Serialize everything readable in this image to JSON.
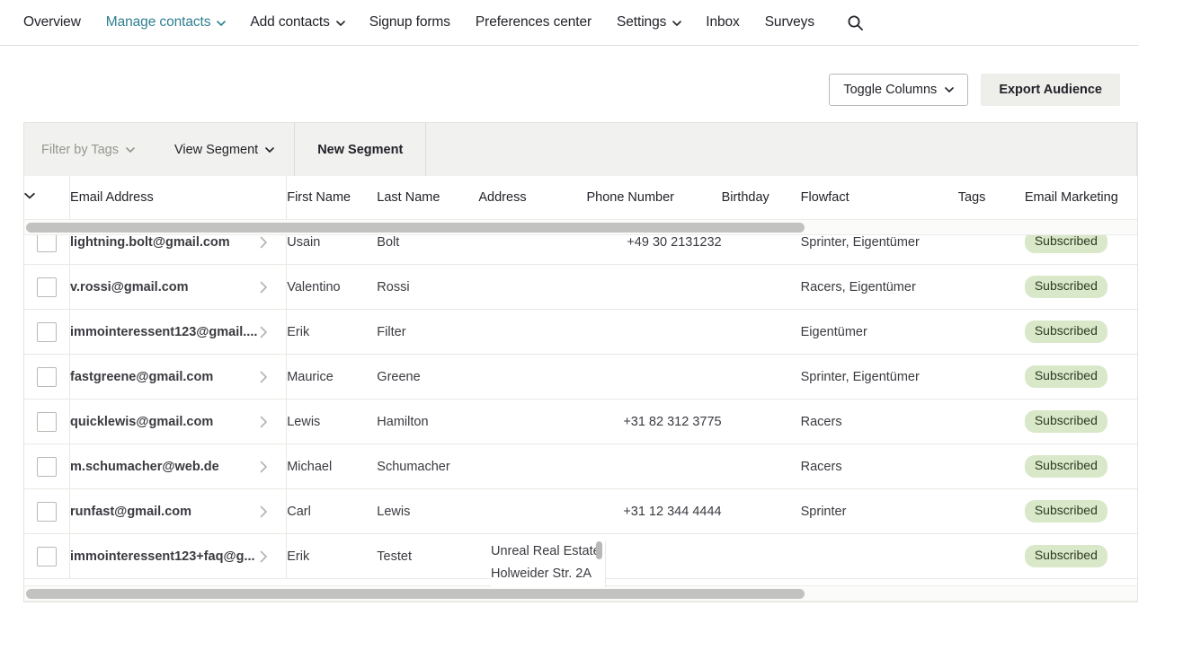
{
  "nav": {
    "items": [
      {
        "label": "Overview",
        "has_caret": false,
        "active": false
      },
      {
        "label": "Manage contacts",
        "has_caret": true,
        "active": true
      },
      {
        "label": "Add contacts",
        "has_caret": true,
        "active": false
      },
      {
        "label": "Signup forms",
        "has_caret": false,
        "active": false
      },
      {
        "label": "Preferences center",
        "has_caret": false,
        "active": false
      },
      {
        "label": "Settings",
        "has_caret": true,
        "active": false
      },
      {
        "label": "Inbox",
        "has_caret": false,
        "active": false
      },
      {
        "label": "Surveys",
        "has_caret": false,
        "active": false
      }
    ],
    "search_icon": "search-icon"
  },
  "actions": {
    "toggle_columns": "Toggle Columns",
    "export_audience": "Export Audience"
  },
  "filterbar": {
    "filter_by_tags": "Filter by Tags",
    "view_segment": "View Segment",
    "new_segment": "New Segment"
  },
  "table": {
    "headers": {
      "select_all": "",
      "email": "Email Address",
      "first_name": "First Name",
      "last_name": "Last Name",
      "address": "Address",
      "phone": "Phone Number",
      "birthday": "Birthday",
      "flowfact": "Flowfact",
      "tags": "Tags",
      "email_marketing": "Email Marketing"
    },
    "rows": [
      {
        "email": "lightning.bolt@gmail.com",
        "first_name": "Usain",
        "last_name": "Bolt",
        "address": "",
        "phone": "+49 30 2131232",
        "birthday": "",
        "flowfact": "Sprinter, Eigentümer",
        "tags": "",
        "email_marketing": "Subscribed"
      },
      {
        "email": "v.rossi@gmail.com",
        "first_name": "Valentino",
        "last_name": "Rossi",
        "address": "",
        "phone": "",
        "birthday": "",
        "flowfact": "Racers, Eigentümer",
        "tags": "",
        "email_marketing": "Subscribed"
      },
      {
        "email": "immointeressent123@gmail....",
        "first_name": "Erik",
        "last_name": "Filter",
        "address": "",
        "phone": "",
        "birthday": "",
        "flowfact": "Eigentümer",
        "tags": "",
        "email_marketing": "Subscribed"
      },
      {
        "email": "fastgreene@gmail.com",
        "first_name": "Maurice",
        "last_name": "Greene",
        "address": "",
        "phone": "",
        "birthday": "",
        "flowfact": "Sprinter, Eigentümer",
        "tags": "",
        "email_marketing": "Subscribed"
      },
      {
        "email": "quicklewis@gmail.com",
        "first_name": "Lewis",
        "last_name": "Hamilton",
        "address": "",
        "phone": "+31 82 312 3775",
        "birthday": "",
        "flowfact": "Racers",
        "tags": "",
        "email_marketing": "Subscribed"
      },
      {
        "email": "m.schumacher@web.de",
        "first_name": "Michael",
        "last_name": "Schumacher",
        "address": "",
        "phone": "",
        "birthday": "",
        "flowfact": "Racers",
        "tags": "",
        "email_marketing": "Subscribed"
      },
      {
        "email": "runfast@gmail.com",
        "first_name": "Carl",
        "last_name": "Lewis",
        "address": "",
        "phone": "+31 12 344 4444",
        "birthday": "",
        "flowfact": "Sprinter",
        "tags": "",
        "email_marketing": "Subscribed"
      },
      {
        "email": "immointeressent123+faq@g...",
        "first_name": "Erik",
        "last_name": "Testet",
        "address": "",
        "phone": "",
        "birthday": "",
        "flowfact": "",
        "tags": "",
        "email_marketing": "Subscribed"
      }
    ]
  },
  "address_popup": {
    "line1": "Unreal Real Estate",
    "line2": "Holweider Str. 2A"
  },
  "colors": {
    "nav_active": "#2f7f91",
    "badge_bg": "#d9e8c9",
    "filterbar_bg": "#f1f1ef",
    "button_solid_bg": "#eeeeea",
    "border": "#e8e8e4",
    "scrollbar_thumb": "#c2c2c0"
  }
}
